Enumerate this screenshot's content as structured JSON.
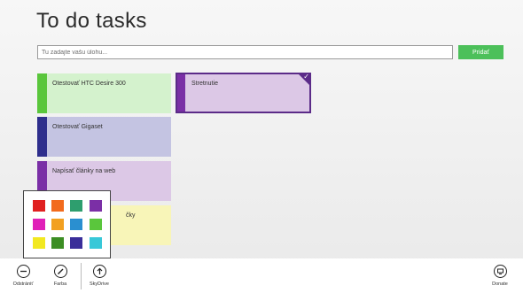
{
  "app": {
    "title": "To do tasks"
  },
  "input": {
    "placeholder": "Tu zadajte vašu úlohu...",
    "value": ""
  },
  "add_button": {
    "label": "Pridať",
    "color": "#4cc05a"
  },
  "tasks": [
    {
      "label": "Otestovať HTC Desire 300",
      "accent": "#5ac63c",
      "bg": "#d4f2cd",
      "selected": false
    },
    {
      "label": "Otestovať Gigaset",
      "accent": "#2e2e8c",
      "bg": "#c4c4e2",
      "selected": false
    },
    {
      "label": "Napísať články na web",
      "accent": "#7a2fa6",
      "bg": "#dcc8e6",
      "selected": false
    },
    {
      "label": "čky",
      "accent": "#e8e020",
      "bg": "#f8f5b8",
      "selected": false
    },
    {
      "label": "Stretnutie",
      "accent": "#7a2fa6",
      "bg": "#dcc8e6",
      "selected": true
    }
  ],
  "color_picker": {
    "colors": [
      "#e02020",
      "#f26b1d",
      "#2e9e6e",
      "#7b2fa6",
      "#e020b8",
      "#f2a020",
      "#2a8fd0",
      "#5ac63c",
      "#f2e820",
      "#3c8e24",
      "#3a2e9a",
      "#38c8d8"
    ]
  },
  "appbar": {
    "delete_label": "Odstrániť",
    "color_label": "Farba",
    "skydrive_label": "SkyDrive",
    "donate_label": "Donate"
  }
}
